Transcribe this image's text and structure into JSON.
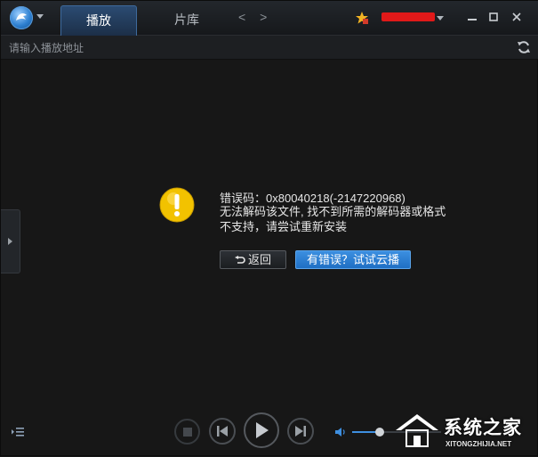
{
  "titlebar": {
    "tabs": [
      {
        "label": "播放",
        "active": true
      },
      {
        "label": "片库",
        "active": false
      }
    ],
    "nav_arrows": "< >"
  },
  "address_bar": {
    "placeholder": "请输入播放地址"
  },
  "error": {
    "code_line": "错误码：0x80040218(-2147220968)",
    "message": "无法解码该文件, 找不到所需的解码器或格式不支持，请尝试重新安装",
    "back_label": "返回",
    "cloud_label": "有错误？试试云播"
  },
  "controls": {
    "volume_level": 0.31
  },
  "watermark": {
    "title": "系统之家",
    "subtitle": "XITONGZHIJIA.NET"
  },
  "colors": {
    "accent": "#2f82d6",
    "background": "#171717",
    "warning": "#f2c200"
  },
  "icons": [
    "logo-icon",
    "star-vip-icon",
    "minimize-icon",
    "maximize-icon",
    "close-icon",
    "refresh-icon",
    "warning-icon",
    "undo-icon",
    "playlist-icon",
    "stop-icon",
    "previous-icon",
    "play-icon",
    "next-icon",
    "volume-icon"
  ]
}
